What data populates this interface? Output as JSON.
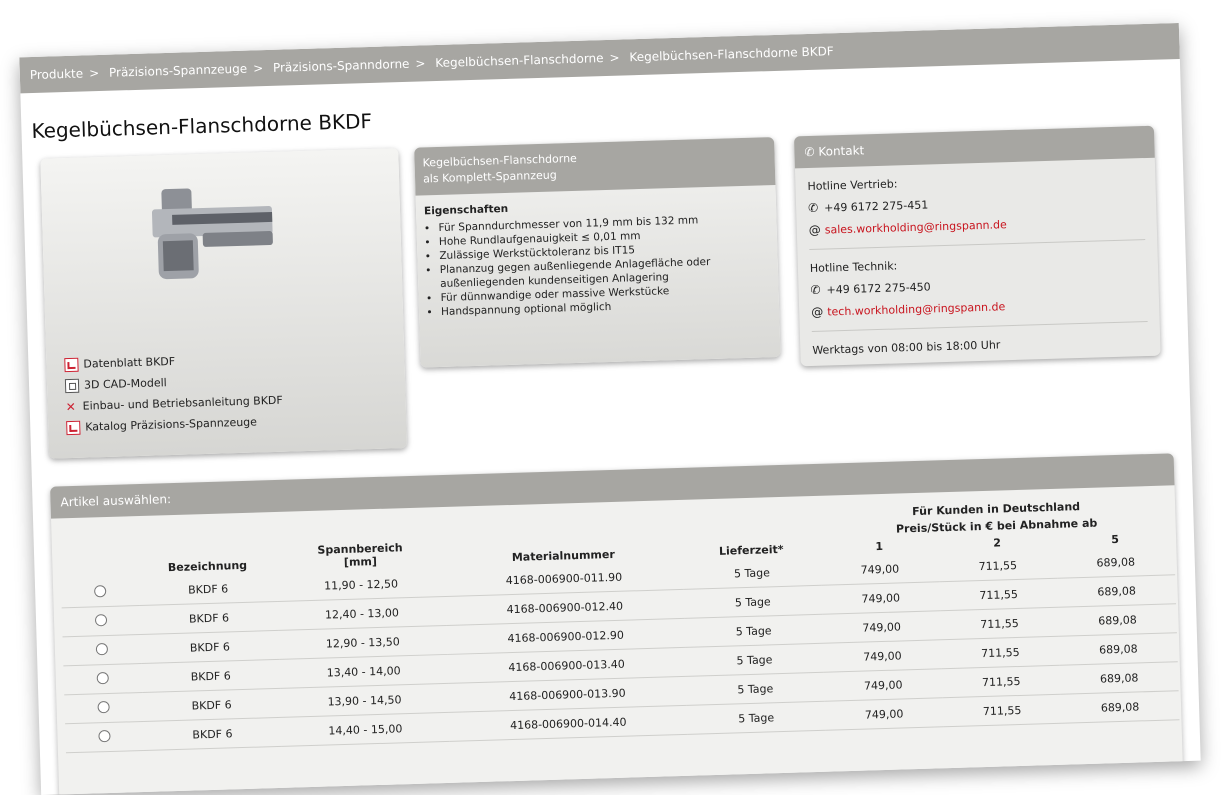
{
  "breadcrumb": [
    "Produkte",
    "Präzisions-Spannzeuge",
    "Präzisions-Spanndorne",
    "Kegelbüchsen-Flanschdorne",
    "Kegelbüchsen-Flanschdorne BKDF"
  ],
  "page_title": "Kegelbüchsen-Flanschdorne BKDF",
  "downloads": [
    {
      "icon": "pdf-icon",
      "label": "Datenblatt BKDF"
    },
    {
      "icon": "cad-model-icon",
      "label": "3D CAD-Modell"
    },
    {
      "icon": "tools-icon",
      "label": "Einbau- und Betriebsanleitung BKDF"
    },
    {
      "icon": "pdf-icon",
      "label": "Katalog Präzisions-Spannzeuge"
    }
  ],
  "description": {
    "header_line1": "Kegelbüchsen-Flanschdorne",
    "header_line2": "als Komplett-Spannzeug",
    "title": "Eigenschaften",
    "items": [
      "Für Spanndurchmesser von 11,9 mm bis 132 mm",
      "Hohe Rundlaufgenauigkeit ≤ 0,01 mm",
      "Zulässige Werkstücktoleranz bis IT15",
      "Plananzug gegen außenliegende Anlagefläche oder außenliegenden kundenseitigen Anlagering",
      "Für dünnwandige oder massive Werkstücke",
      "Handspannung optional möglich"
    ]
  },
  "contact": {
    "title": "Kontakt",
    "sales_label": "Hotline Vertrieb:",
    "sales_phone": "+49 6172 275-451",
    "sales_email": "sales.workholding@ringspann.de",
    "tech_label": "Hotline Technik:",
    "tech_phone": "+49 6172 275-450",
    "tech_email": "tech.workholding@ringspann.de",
    "hours": "Werktags von 08:00 bis 18:00 Uhr"
  },
  "articles": {
    "title": "Artikel auswählen:",
    "headers": {
      "bezeichnung": "Bezeichnung",
      "spannbereich": "Spannbereich",
      "spannbereich_unit": "[mm]",
      "materialnummer": "Materialnummer",
      "lieferzeit": "Lieferzeit*",
      "price_line1": "Für Kunden in Deutschland",
      "price_line2": "Preis/Stück in € bei Abnahme ab",
      "qty": [
        "1",
        "2",
        "5"
      ]
    },
    "rows": [
      {
        "name": "BKDF 6",
        "range": "11,90 - 12,50",
        "material": "4168-006900-011.90",
        "delivery": "5 Tage",
        "p1": "749,00",
        "p2": "711,55",
        "p5": "689,08"
      },
      {
        "name": "BKDF 6",
        "range": "12,40 - 13,00",
        "material": "4168-006900-012.40",
        "delivery": "5 Tage",
        "p1": "749,00",
        "p2": "711,55",
        "p5": "689,08"
      },
      {
        "name": "BKDF 6",
        "range": "12,90 - 13,50",
        "material": "4168-006900-012.90",
        "delivery": "5 Tage",
        "p1": "749,00",
        "p2": "711,55",
        "p5": "689,08"
      },
      {
        "name": "BKDF 6",
        "range": "13,40 - 14,00",
        "material": "4168-006900-013.40",
        "delivery": "5 Tage",
        "p1": "749,00",
        "p2": "711,55",
        "p5": "689,08"
      },
      {
        "name": "BKDF 6",
        "range": "13,90 - 14,50",
        "material": "4168-006900-013.90",
        "delivery": "5 Tage",
        "p1": "749,00",
        "p2": "711,55",
        "p5": "689,08"
      },
      {
        "name": "BKDF 6",
        "range": "14,40 - 15,00",
        "material": "4168-006900-014.40",
        "delivery": "5 Tage",
        "p1": "749,00",
        "p2": "711,55",
        "p5": "689,08"
      }
    ]
  }
}
